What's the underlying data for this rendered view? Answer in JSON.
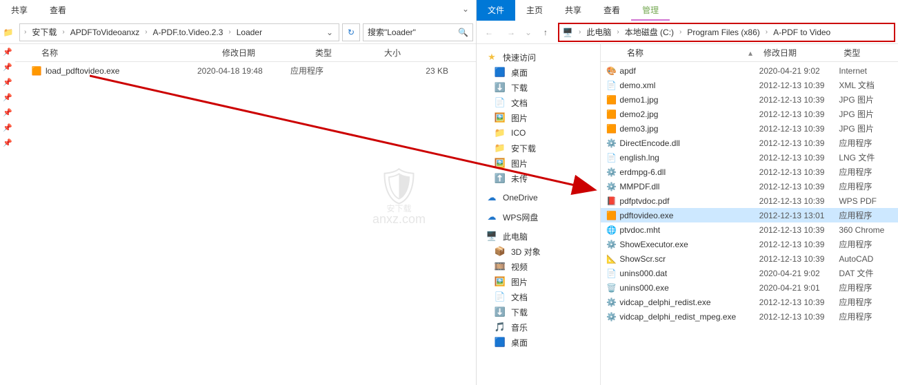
{
  "left": {
    "ribbon": {
      "share": "共享",
      "view": "查看"
    },
    "breadcrumb": [
      "安下载",
      "APDFToVideoanxz",
      "A-PDF.to.Video.2.3",
      "Loader"
    ],
    "search_placeholder": "搜索\"Loader\"",
    "columns": {
      "name": "名称",
      "date": "修改日期",
      "type": "类型",
      "size": "大小"
    },
    "files": [
      {
        "icon": "exe",
        "name": "load_pdftovideo.exe",
        "date": "2020-04-18 19:48",
        "type": "应用程序",
        "size": "23 KB"
      }
    ]
  },
  "right": {
    "ribbon": {
      "file": "文件",
      "home": "主页",
      "share": "共享",
      "view": "查看",
      "manage": "管理"
    },
    "breadcrumb": [
      "此电脑",
      "本地磁盘 (C:)",
      "Program Files (x86)",
      "A-PDF to Video"
    ],
    "columns": {
      "name": "名称",
      "date": "修改日期",
      "type": "类型"
    },
    "nav": {
      "quick": "快速访问",
      "quick_items": [
        {
          "icon": "desk",
          "label": "桌面"
        },
        {
          "icon": "down",
          "label": "下载"
        },
        {
          "icon": "doc",
          "label": "文档"
        },
        {
          "icon": "pic",
          "label": "图片"
        },
        {
          "icon": "folder",
          "label": "ICO"
        },
        {
          "icon": "folder",
          "label": "安下载"
        },
        {
          "icon": "pic",
          "label": "图片"
        },
        {
          "icon": "upload",
          "label": "未传"
        }
      ],
      "onedrive": "OneDrive",
      "wps": "WPS网盘",
      "thispc": "此电脑",
      "pc_items": [
        {
          "icon": "3d",
          "label": "3D 对象"
        },
        {
          "icon": "vid",
          "label": "视频"
        },
        {
          "icon": "pic",
          "label": "图片"
        },
        {
          "icon": "doc",
          "label": "文档"
        },
        {
          "icon": "down",
          "label": "下载"
        },
        {
          "icon": "music",
          "label": "音乐"
        },
        {
          "icon": "desk",
          "label": "桌面"
        }
      ]
    },
    "files": [
      {
        "icon": "app",
        "name": "apdf",
        "date": "2020-04-21 9:02",
        "type": "Internet"
      },
      {
        "icon": "xml",
        "name": "demo.xml",
        "date": "2012-12-13 10:39",
        "type": "XML 文档"
      },
      {
        "icon": "jpg",
        "name": "demo1.jpg",
        "date": "2012-12-13 10:39",
        "type": "JPG 图片"
      },
      {
        "icon": "jpg",
        "name": "demo2.jpg",
        "date": "2012-12-13 10:39",
        "type": "JPG 图片"
      },
      {
        "icon": "jpg",
        "name": "demo3.jpg",
        "date": "2012-12-13 10:39",
        "type": "JPG 图片"
      },
      {
        "icon": "dll",
        "name": "DirectEncode.dll",
        "date": "2012-12-13 10:39",
        "type": "应用程序"
      },
      {
        "icon": "lng",
        "name": "english.lng",
        "date": "2012-12-13 10:39",
        "type": "LNG 文件"
      },
      {
        "icon": "dll",
        "name": "erdmpg-6.dll",
        "date": "2012-12-13 10:39",
        "type": "应用程序"
      },
      {
        "icon": "dll",
        "name": "MMPDF.dll",
        "date": "2012-12-13 10:39",
        "type": "应用程序"
      },
      {
        "icon": "pdf",
        "name": "pdfptvdoc.pdf",
        "date": "2012-12-13 10:39",
        "type": "WPS PDF"
      },
      {
        "icon": "exe",
        "name": "pdftovideo.exe",
        "date": "2012-12-13 13:01",
        "type": "应用程序",
        "selected": true
      },
      {
        "icon": "mht",
        "name": "ptvdoc.mht",
        "date": "2012-12-13 10:39",
        "type": "360 Chrome"
      },
      {
        "icon": "exe2",
        "name": "ShowExecutor.exe",
        "date": "2012-12-13 10:39",
        "type": "应用程序"
      },
      {
        "icon": "scr",
        "name": "ShowScr.scr",
        "date": "2012-12-13 10:39",
        "type": "AutoCAD"
      },
      {
        "icon": "dat",
        "name": "unins000.dat",
        "date": "2020-04-21 9:02",
        "type": "DAT 文件"
      },
      {
        "icon": "uninst",
        "name": "unins000.exe",
        "date": "2020-04-21 9:01",
        "type": "应用程序"
      },
      {
        "icon": "exe2",
        "name": "vidcap_delphi_redist.exe",
        "date": "2012-12-13 10:39",
        "type": "应用程序"
      },
      {
        "icon": "exe2",
        "name": "vidcap_delphi_redist_mpeg.exe",
        "date": "2012-12-13 10:39",
        "type": "应用程序"
      }
    ]
  },
  "watermark": {
    "text": "安下载",
    "sub": "anxz.com"
  }
}
